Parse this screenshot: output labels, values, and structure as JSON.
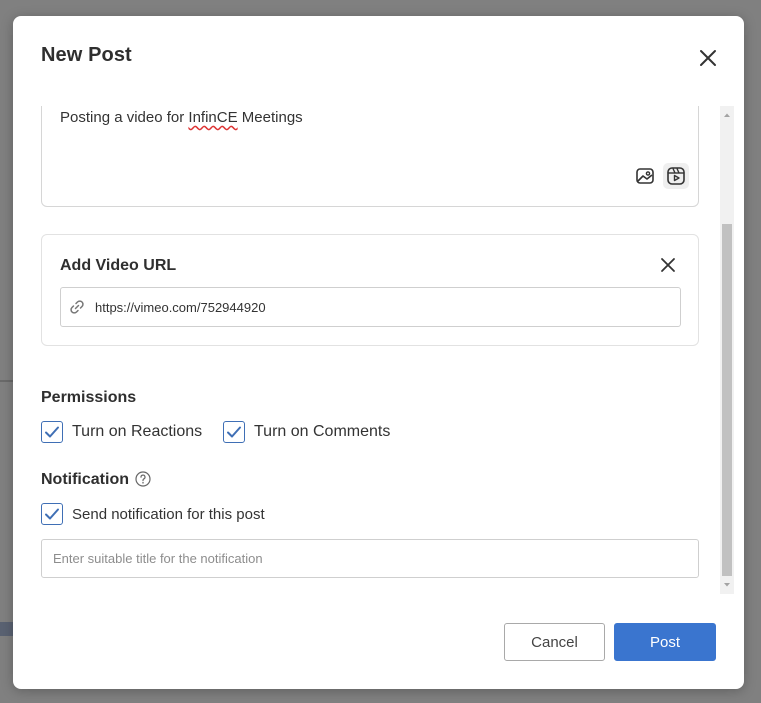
{
  "modal": {
    "title": "New Post"
  },
  "post": {
    "text_before": "Posting a video for ",
    "text_misspelled": "InfinCE",
    "text_after": " Meetings"
  },
  "video": {
    "title": "Add Video URL",
    "url_value": "https://vimeo.com/752944920"
  },
  "permissions": {
    "label": "Permissions",
    "reactions_label": "Turn on Reactions",
    "reactions_checked": true,
    "comments_label": "Turn on Comments",
    "comments_checked": true
  },
  "notification": {
    "label": "Notification",
    "send_label": "Send notification for this post",
    "send_checked": true,
    "title_placeholder": "Enter suitable title for the notification",
    "title_value": ""
  },
  "footer": {
    "cancel_label": "Cancel",
    "post_label": "Post"
  },
  "colors": {
    "accent": "#3a75cf",
    "checkbox_border": "#3f6fb5"
  }
}
